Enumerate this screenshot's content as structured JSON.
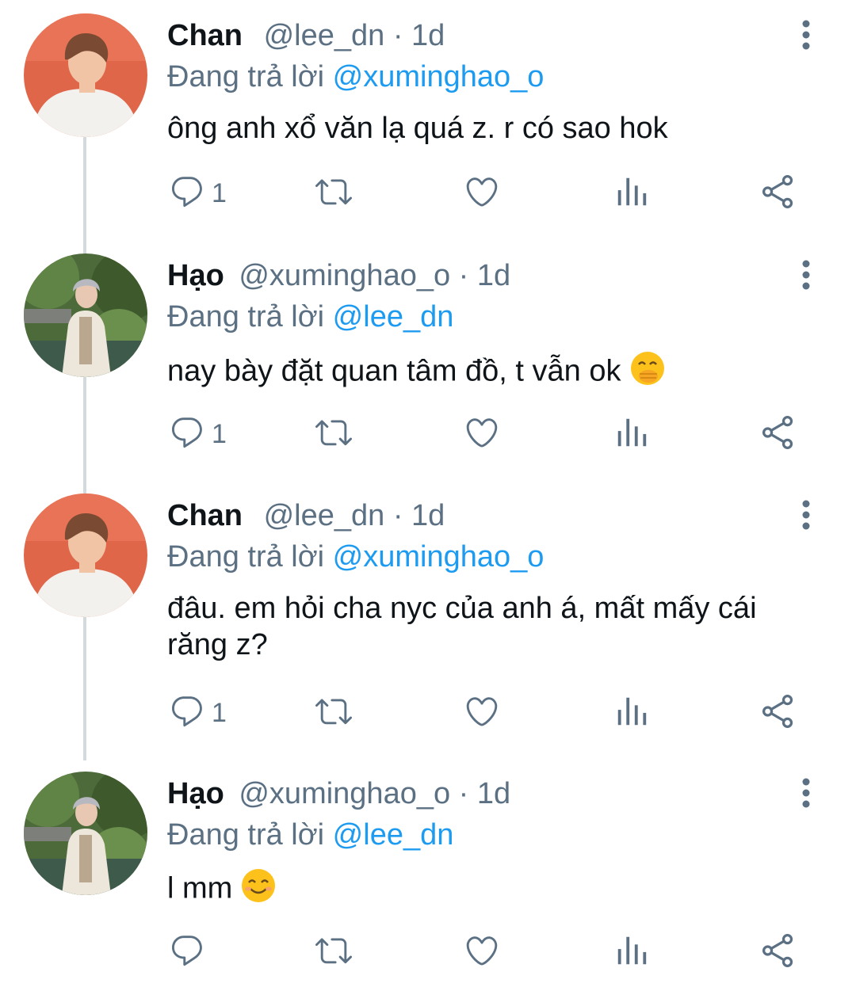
{
  "tweets": [
    {
      "name": "Chan",
      "handle": "@lee_dn",
      "time": "· 1d",
      "reply_prefix": "Đang trả lời",
      "reply_to": "@xuminghao_o",
      "text": "ông anh xổ văn lạ quá z. r có sao hok",
      "reply_count": "1",
      "avatar": "chan-avatar"
    },
    {
      "name": "Hạo",
      "handle": "@xuminghao_o",
      "time": "· 1d",
      "reply_prefix": "Đang trả lời",
      "reply_to": "@lee_dn",
      "text": "nay bày đặt quan tâm đồ, t vẫn ok",
      "emoji": "hand-over-mouth-emoji",
      "reply_count": "1",
      "avatar": "hao-avatar"
    },
    {
      "name": "Chan",
      "handle": "@lee_dn",
      "time": "· 1d",
      "reply_prefix": "Đang trả lời",
      "reply_to": "@xuminghao_o",
      "text": "đâu. em hỏi cha nyc của anh á, mất mấy cái răng z?",
      "reply_count": "1",
      "avatar": "chan-avatar"
    },
    {
      "name": "Hạo",
      "handle": "@xuminghao_o",
      "time": "· 1d",
      "reply_prefix": "Đang trả lời",
      "reply_to": "@lee_dn",
      "text": "l mm",
      "emoji": "smiling-emoji",
      "reply_count": "",
      "avatar": "hao-avatar"
    }
  ],
  "colors": {
    "text": "#0f1419",
    "muted": "#5b7083",
    "mention": "#1d9bf0",
    "thread_line": "#d4d9dd"
  }
}
